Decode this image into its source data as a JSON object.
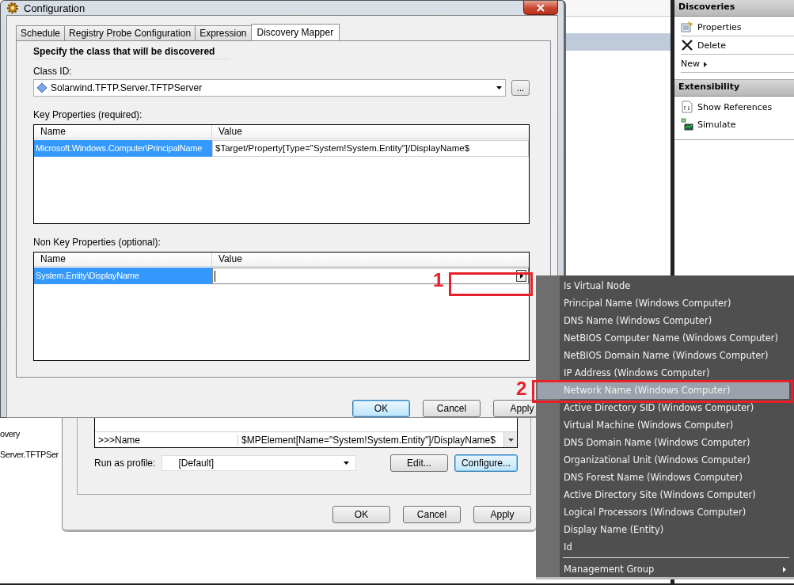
{
  "background_text": [
    "overy",
    "Server.TFTPSer"
  ],
  "actions_pane": {
    "sections": [
      {
        "title": "Discoveries",
        "items": [
          {
            "label": "Properties",
            "kind": "properties"
          },
          {
            "label": "Delete",
            "kind": "delete"
          },
          {
            "label": "New",
            "kind": "submenu"
          }
        ]
      },
      {
        "title": "Extensibility",
        "items": [
          {
            "label": "Show References",
            "kind": "references"
          },
          {
            "label": "Simulate",
            "kind": "simulate"
          }
        ]
      }
    ]
  },
  "back_dialog": {
    "rows": [
      {
        "name": ">>>Name",
        "value": "$MPElement[Name=\"System!System.Entity\"]/DisplayName$"
      }
    ],
    "run_as": {
      "label": "Run as profile:",
      "value": "[Default]"
    },
    "actions": [
      {
        "label": "Edit...",
        "default": false
      },
      {
        "label": "Configure...",
        "default": true
      }
    ],
    "buttons": [
      {
        "label": "OK",
        "default": false
      },
      {
        "label": "Cancel",
        "default": false
      },
      {
        "label": "Apply",
        "default": false
      }
    ]
  },
  "front_dialog": {
    "title": "Configuration",
    "tabs": [
      {
        "label": "Schedule",
        "selected": false
      },
      {
        "label": "Registry Probe Configuration",
        "selected": false
      },
      {
        "label": "Expression",
        "selected": false
      },
      {
        "label": "Discovery Mapper",
        "selected": true
      }
    ],
    "heading": "Specify the class that will be discovered",
    "class_id": {
      "label": "Class ID:",
      "value": "Solarwind.TFTP.Server.TFTPServer",
      "browse_button": "..."
    },
    "key_properties": {
      "label": "Key Properties (required):",
      "columns": [
        "Name",
        "Value"
      ],
      "rows": [
        {
          "name": "Microsoft.Windows.Computer\\PrincipalName",
          "value": "$Target/Property[Type=\"System!System.Entity\"]/DisplayName$",
          "selected": true,
          "editing": false
        }
      ]
    },
    "non_key_properties": {
      "label": "Non Key Properties (optional):",
      "columns": [
        "Name",
        "Value"
      ],
      "rows": [
        {
          "name": "System.Entity\\DisplayName",
          "selected": true,
          "editing": true
        }
      ]
    },
    "buttons": [
      {
        "label": "OK",
        "default": true
      },
      {
        "label": "Cancel",
        "default": false
      },
      {
        "label": "Apply",
        "default": false
      }
    ]
  },
  "context_menu": {
    "items": [
      {
        "label": "Is Virtual Node",
        "selected": false,
        "kind": "item"
      },
      {
        "label": "Principal Name (Windows Computer)",
        "selected": false,
        "kind": "item"
      },
      {
        "label": "DNS Name (Windows Computer)",
        "selected": false,
        "kind": "item"
      },
      {
        "label": "NetBIOS Computer Name (Windows Computer)",
        "selected": false,
        "kind": "item"
      },
      {
        "label": "NetBIOS Domain Name (Windows Computer)",
        "selected": false,
        "kind": "item"
      },
      {
        "label": "IP Address (Windows Computer)",
        "selected": false,
        "kind": "item"
      },
      {
        "label": "Network Name (Windows Computer)",
        "selected": true,
        "kind": "item"
      },
      {
        "label": "Active Directory SID (Windows Computer)",
        "selected": false,
        "kind": "item"
      },
      {
        "label": "Virtual Machine (Windows Computer)",
        "selected": false,
        "kind": "item"
      },
      {
        "label": "DNS Domain Name (Windows Computer)",
        "selected": false,
        "kind": "item"
      },
      {
        "label": "Organizational Unit (Windows Computer)",
        "selected": false,
        "kind": "item"
      },
      {
        "label": "DNS Forest Name (Windows Computer)",
        "selected": false,
        "kind": "item"
      },
      {
        "label": "Active Directory Site (Windows Computer)",
        "selected": false,
        "kind": "item"
      },
      {
        "label": "Logical Processors (Windows Computer)",
        "selected": false,
        "kind": "item"
      },
      {
        "label": "Display Name (Entity)",
        "selected": false,
        "kind": "item"
      },
      {
        "label": "Id",
        "selected": false,
        "kind": "item"
      },
      {
        "label": "Management Group",
        "selected": false,
        "kind": "submenu"
      }
    ]
  },
  "annotations": [
    {
      "label": "1"
    },
    {
      "label": "2"
    }
  ]
}
